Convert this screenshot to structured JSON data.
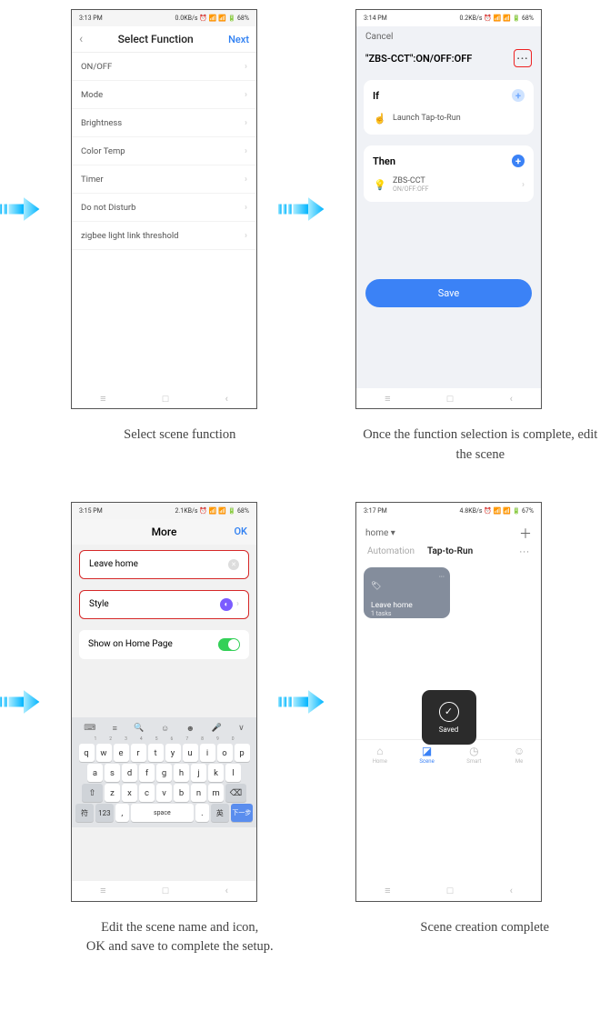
{
  "arrows": {
    "colorStart": "#00c6ff",
    "colorEnd": "#0acffe"
  },
  "screen1": {
    "time": "3:13 PM",
    "status_right": "0.0KB/s ⏰ 📶 📶 🔋 68%",
    "header": {
      "back": "‹",
      "title": "Select Function",
      "next": "Next"
    },
    "functions": [
      "ON/OFF",
      "Mode",
      "Brightness",
      "Color Temp",
      "Timer",
      "Do not Disturb",
      "zigbee light link threshold"
    ]
  },
  "screen2": {
    "time": "3:14 PM",
    "status_right": "0.2KB/s ⏰ 📶 📶 🔋 68%",
    "cancel": "Cancel",
    "name": "\"ZBS-CCT\":ON/OFF:OFF",
    "if_label": "If",
    "if_item": "Launch Tap-to-Run",
    "then_label": "Then",
    "then_device": "ZBS-CCT",
    "then_sub": "ON/OFF:OFF",
    "save": "Save"
  },
  "screen3": {
    "time": "3:15 PM",
    "status_right": "2.1KB/s ⏰ 📶 📶 🔋 68%",
    "title": "More",
    "ok": "OK",
    "name_field": "Leave home",
    "style_label": "Style",
    "show_home": "Show on Home Page",
    "keyboard": {
      "toolbar_icons": [
        "⌨",
        "≡",
        "🔍",
        "☺",
        "☻",
        "🎤",
        "∨"
      ],
      "row1": [
        "q",
        "w",
        "e",
        "r",
        "t",
        "y",
        "u",
        "i",
        "o",
        "p"
      ],
      "row2": [
        "a",
        "s",
        "d",
        "f",
        "g",
        "h",
        "j",
        "k",
        "l"
      ],
      "row3_shift": "⇧",
      "row3": [
        "z",
        "x",
        "c",
        "v",
        "b",
        "n",
        "m"
      ],
      "row3_bksp": "⌫",
      "row4": {
        "sym": "符",
        "num": "123",
        "comma": ",",
        "space": "space",
        "period": ".",
        "lang": "英",
        "enter": "下一步"
      }
    }
  },
  "screen4": {
    "time": "3:17 PM",
    "status_right": "4.8KB/s ⏰ 📶 📶 🔋 67%",
    "home_label": "home ▾",
    "add": "＋",
    "tab_automation": "Automation",
    "tab_taptorun": "Tap-to-Run",
    "scene": {
      "title": "Leave home",
      "sub": "1 tasks"
    },
    "saved": "Saved",
    "bottom": {
      "home": "Home",
      "scene": "Scene",
      "smart": "Smart",
      "me": "Me"
    }
  },
  "captions": {
    "c1": "Select scene function",
    "c2": "Once the function selection is complete, edit the scene",
    "c3a": "Edit the scene name and icon,",
    "c3b": "OK and save to complete the setup.",
    "c4": "Scene creation complete"
  }
}
